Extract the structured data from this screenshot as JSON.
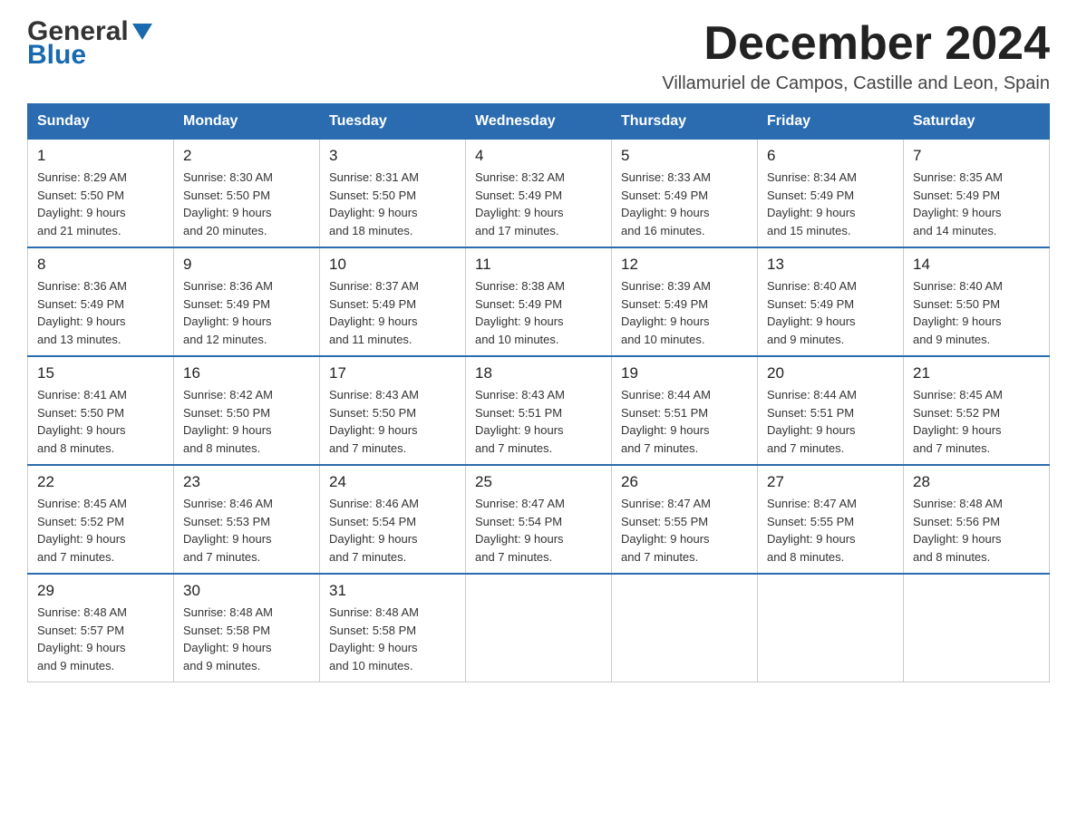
{
  "logo": {
    "general": "General",
    "blue": "Blue"
  },
  "title": "December 2024",
  "subtitle": "Villamuriel de Campos, Castille and Leon, Spain",
  "weekdays": [
    "Sunday",
    "Monday",
    "Tuesday",
    "Wednesday",
    "Thursday",
    "Friday",
    "Saturday"
  ],
  "weeks": [
    [
      {
        "day": "1",
        "sunrise": "8:29 AM",
        "sunset": "5:50 PM",
        "daylight": "9 hours and 21 minutes."
      },
      {
        "day": "2",
        "sunrise": "8:30 AM",
        "sunset": "5:50 PM",
        "daylight": "9 hours and 20 minutes."
      },
      {
        "day": "3",
        "sunrise": "8:31 AM",
        "sunset": "5:50 PM",
        "daylight": "9 hours and 18 minutes."
      },
      {
        "day": "4",
        "sunrise": "8:32 AM",
        "sunset": "5:49 PM",
        "daylight": "9 hours and 17 minutes."
      },
      {
        "day": "5",
        "sunrise": "8:33 AM",
        "sunset": "5:49 PM",
        "daylight": "9 hours and 16 minutes."
      },
      {
        "day": "6",
        "sunrise": "8:34 AM",
        "sunset": "5:49 PM",
        "daylight": "9 hours and 15 minutes."
      },
      {
        "day": "7",
        "sunrise": "8:35 AM",
        "sunset": "5:49 PM",
        "daylight": "9 hours and 14 minutes."
      }
    ],
    [
      {
        "day": "8",
        "sunrise": "8:36 AM",
        "sunset": "5:49 PM",
        "daylight": "9 hours and 13 minutes."
      },
      {
        "day": "9",
        "sunrise": "8:36 AM",
        "sunset": "5:49 PM",
        "daylight": "9 hours and 12 minutes."
      },
      {
        "day": "10",
        "sunrise": "8:37 AM",
        "sunset": "5:49 PM",
        "daylight": "9 hours and 11 minutes."
      },
      {
        "day": "11",
        "sunrise": "8:38 AM",
        "sunset": "5:49 PM",
        "daylight": "9 hours and 10 minutes."
      },
      {
        "day": "12",
        "sunrise": "8:39 AM",
        "sunset": "5:49 PM",
        "daylight": "9 hours and 10 minutes."
      },
      {
        "day": "13",
        "sunrise": "8:40 AM",
        "sunset": "5:49 PM",
        "daylight": "9 hours and 9 minutes."
      },
      {
        "day": "14",
        "sunrise": "8:40 AM",
        "sunset": "5:50 PM",
        "daylight": "9 hours and 9 minutes."
      }
    ],
    [
      {
        "day": "15",
        "sunrise": "8:41 AM",
        "sunset": "5:50 PM",
        "daylight": "9 hours and 8 minutes."
      },
      {
        "day": "16",
        "sunrise": "8:42 AM",
        "sunset": "5:50 PM",
        "daylight": "9 hours and 8 minutes."
      },
      {
        "day": "17",
        "sunrise": "8:43 AM",
        "sunset": "5:50 PM",
        "daylight": "9 hours and 7 minutes."
      },
      {
        "day": "18",
        "sunrise": "8:43 AM",
        "sunset": "5:51 PM",
        "daylight": "9 hours and 7 minutes."
      },
      {
        "day": "19",
        "sunrise": "8:44 AM",
        "sunset": "5:51 PM",
        "daylight": "9 hours and 7 minutes."
      },
      {
        "day": "20",
        "sunrise": "8:44 AM",
        "sunset": "5:51 PM",
        "daylight": "9 hours and 7 minutes."
      },
      {
        "day": "21",
        "sunrise": "8:45 AM",
        "sunset": "5:52 PM",
        "daylight": "9 hours and 7 minutes."
      }
    ],
    [
      {
        "day": "22",
        "sunrise": "8:45 AM",
        "sunset": "5:52 PM",
        "daylight": "9 hours and 7 minutes."
      },
      {
        "day": "23",
        "sunrise": "8:46 AM",
        "sunset": "5:53 PM",
        "daylight": "9 hours and 7 minutes."
      },
      {
        "day": "24",
        "sunrise": "8:46 AM",
        "sunset": "5:54 PM",
        "daylight": "9 hours and 7 minutes."
      },
      {
        "day": "25",
        "sunrise": "8:47 AM",
        "sunset": "5:54 PM",
        "daylight": "9 hours and 7 minutes."
      },
      {
        "day": "26",
        "sunrise": "8:47 AM",
        "sunset": "5:55 PM",
        "daylight": "9 hours and 7 minutes."
      },
      {
        "day": "27",
        "sunrise": "8:47 AM",
        "sunset": "5:55 PM",
        "daylight": "9 hours and 8 minutes."
      },
      {
        "day": "28",
        "sunrise": "8:48 AM",
        "sunset": "5:56 PM",
        "daylight": "9 hours and 8 minutes."
      }
    ],
    [
      {
        "day": "29",
        "sunrise": "8:48 AM",
        "sunset": "5:57 PM",
        "daylight": "9 hours and 9 minutes."
      },
      {
        "day": "30",
        "sunrise": "8:48 AM",
        "sunset": "5:58 PM",
        "daylight": "9 hours and 9 minutes."
      },
      {
        "day": "31",
        "sunrise": "8:48 AM",
        "sunset": "5:58 PM",
        "daylight": "9 hours and 10 minutes."
      },
      null,
      null,
      null,
      null
    ]
  ],
  "labels": {
    "sunrise": "Sunrise:",
    "sunset": "Sunset:",
    "daylight": "Daylight:"
  }
}
